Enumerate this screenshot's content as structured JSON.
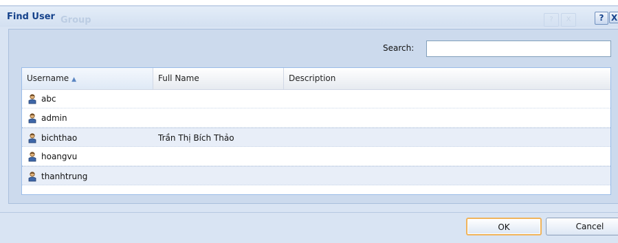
{
  "dialog": {
    "title": "Find User",
    "ghost_title": "Group",
    "help_label": "?",
    "close_label": "X",
    "ghost_help_label": "?",
    "ghost_close_label": "X"
  },
  "search": {
    "label": "Search:",
    "value": "",
    "placeholder": ""
  },
  "grid": {
    "columns": {
      "username": "Username",
      "full_name": "Full Name",
      "description": "Description"
    },
    "sort": {
      "column": "Username",
      "direction": "ascending"
    },
    "rows": [
      {
        "username": "abc",
        "full_name": "",
        "description": ""
      },
      {
        "username": "admin",
        "full_name": "",
        "description": ""
      },
      {
        "username": "bichthao",
        "full_name": "Trần Thị Bích Thảo",
        "description": ""
      },
      {
        "username": "hoangvu",
        "full_name": "",
        "description": ""
      },
      {
        "username": "thanhtrung",
        "full_name": "",
        "description": ""
      }
    ]
  },
  "buttons": {
    "ok": "OK",
    "cancel": "Cancel"
  },
  "icons": {
    "sort_arrow": "sort-ascending-icon",
    "row_icon": "user-icon"
  },
  "colors": {
    "title": "#15428b",
    "dialog_bg": "#d9e4f3",
    "ok_border": "#f0b35a"
  }
}
